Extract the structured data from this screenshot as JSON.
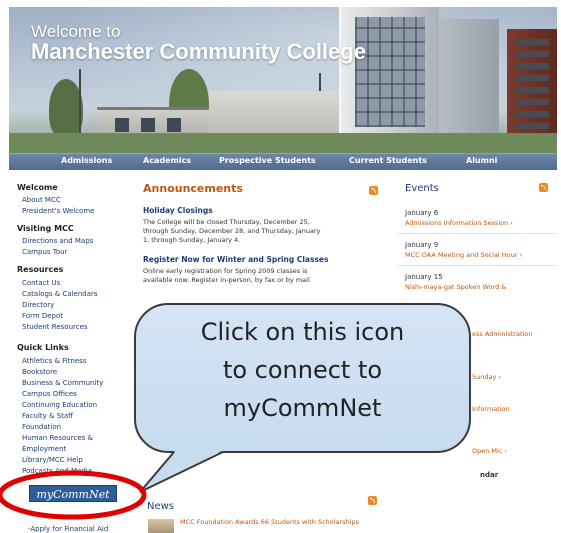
{
  "header": {
    "welcome_line1": "Welcome to",
    "welcome_line2": "Manchester Community College"
  },
  "nav": {
    "items": [
      "Admissions",
      "Academics",
      "Prospective Students",
      "Current Students",
      "Alumni"
    ]
  },
  "sidebar": {
    "welcome": {
      "heading": "Welcome",
      "links": [
        "About MCC",
        "President's Welcome"
      ]
    },
    "visiting": {
      "heading": "Visiting MCC",
      "links": [
        "Directions and Maps",
        "Campus Tour"
      ]
    },
    "resources": {
      "heading": "Resources",
      "links": [
        "Contact Us",
        "Catalogs & Calendars",
        "Directory",
        "Form Depot",
        "Student Resources"
      ]
    },
    "quick_links": {
      "heading": "Quick Links",
      "links": [
        "Athletics & Fitness",
        "Bookstore",
        "Business & Community",
        "Campus Offices",
        "Continuing Education",
        "Faculty & Staff",
        "Foundation",
        "Human Resources &",
        "Employment",
        "Library/MCC Help",
        "Podcasts And Media"
      ]
    },
    "mycommnet_label": "myCommNet",
    "financial_aid": "-Apply for Financial Aid"
  },
  "announcements": {
    "title": "Announcements",
    "items": [
      {
        "heading": "Holiday Closings",
        "lines": [
          "The College will be closed Thursday, December 25,",
          "through Sunday, December 28, and Thursday, January",
          "1, through Sunday, January 4."
        ]
      },
      {
        "heading": "Register Now for Winter and Spring Classes",
        "lines": [
          "Online early registration for Spring 2009 classes is",
          "available now. Register in-person, by fax or by mail"
        ]
      }
    ]
  },
  "events": {
    "title": "Events",
    "items": [
      {
        "date": "January 6",
        "name": "Admissions Information Session ›"
      },
      {
        "date": "January 9",
        "name": "MCC OAA Meeting and Social Hour ›"
      },
      {
        "date": "January 15",
        "name": "Nishi-maya-gat Spoken Word &"
      }
    ],
    "partial": [
      "ess Administration",
      "Sunday ›",
      "Information",
      "Open Mic ›"
    ],
    "calendar_label": "ndar"
  },
  "news": {
    "title": "News",
    "item": "MCC Foundation Awards 66 Students with Scholarships"
  },
  "callout": {
    "lines": [
      "Click on this icon",
      "to connect to",
      "myCommNet"
    ]
  },
  "colors": {
    "nav_bg": "#4f6b8f",
    "link": "#1e3c78",
    "accent_orange": "#c25510",
    "callout_bg": "#c7dbef",
    "highlight_red": "#e00000",
    "mycommnet_bg": "#2f5c9a"
  }
}
